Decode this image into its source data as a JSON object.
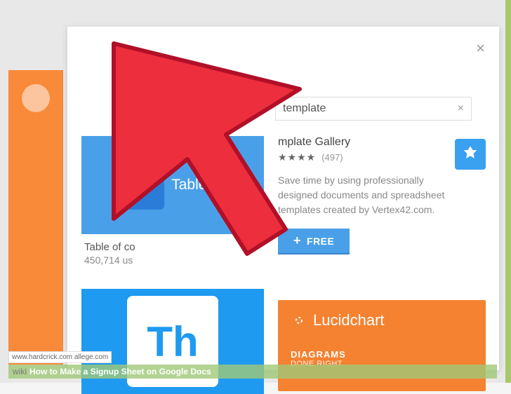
{
  "search": {
    "value": "template",
    "clear_label": "×"
  },
  "modal": {
    "close_label": "×"
  },
  "left_card": {
    "tile_text": "Table of",
    "title": "Table of co",
    "subtitle": "450,714 us"
  },
  "right_card": {
    "title": "mplate Gallery",
    "stars": "★★★★",
    "count": "(497)",
    "description": "Save time by using professionally designed documents and spreadsheet templates created by Vertex42.com.",
    "button_label": "FREE",
    "icon_name": "vertex-icon"
  },
  "lucid": {
    "brand": "Lucidchart",
    "tag": "DIAGRAMS",
    "sub": "DONE RIGHT"
  },
  "th_tile": {
    "label": "Th"
  },
  "watermark": "www.hardcrick.com    allege.com",
  "caption": {
    "prefix": "wiki",
    "text": "How to Make a Signup Sheet on Google Docs"
  }
}
